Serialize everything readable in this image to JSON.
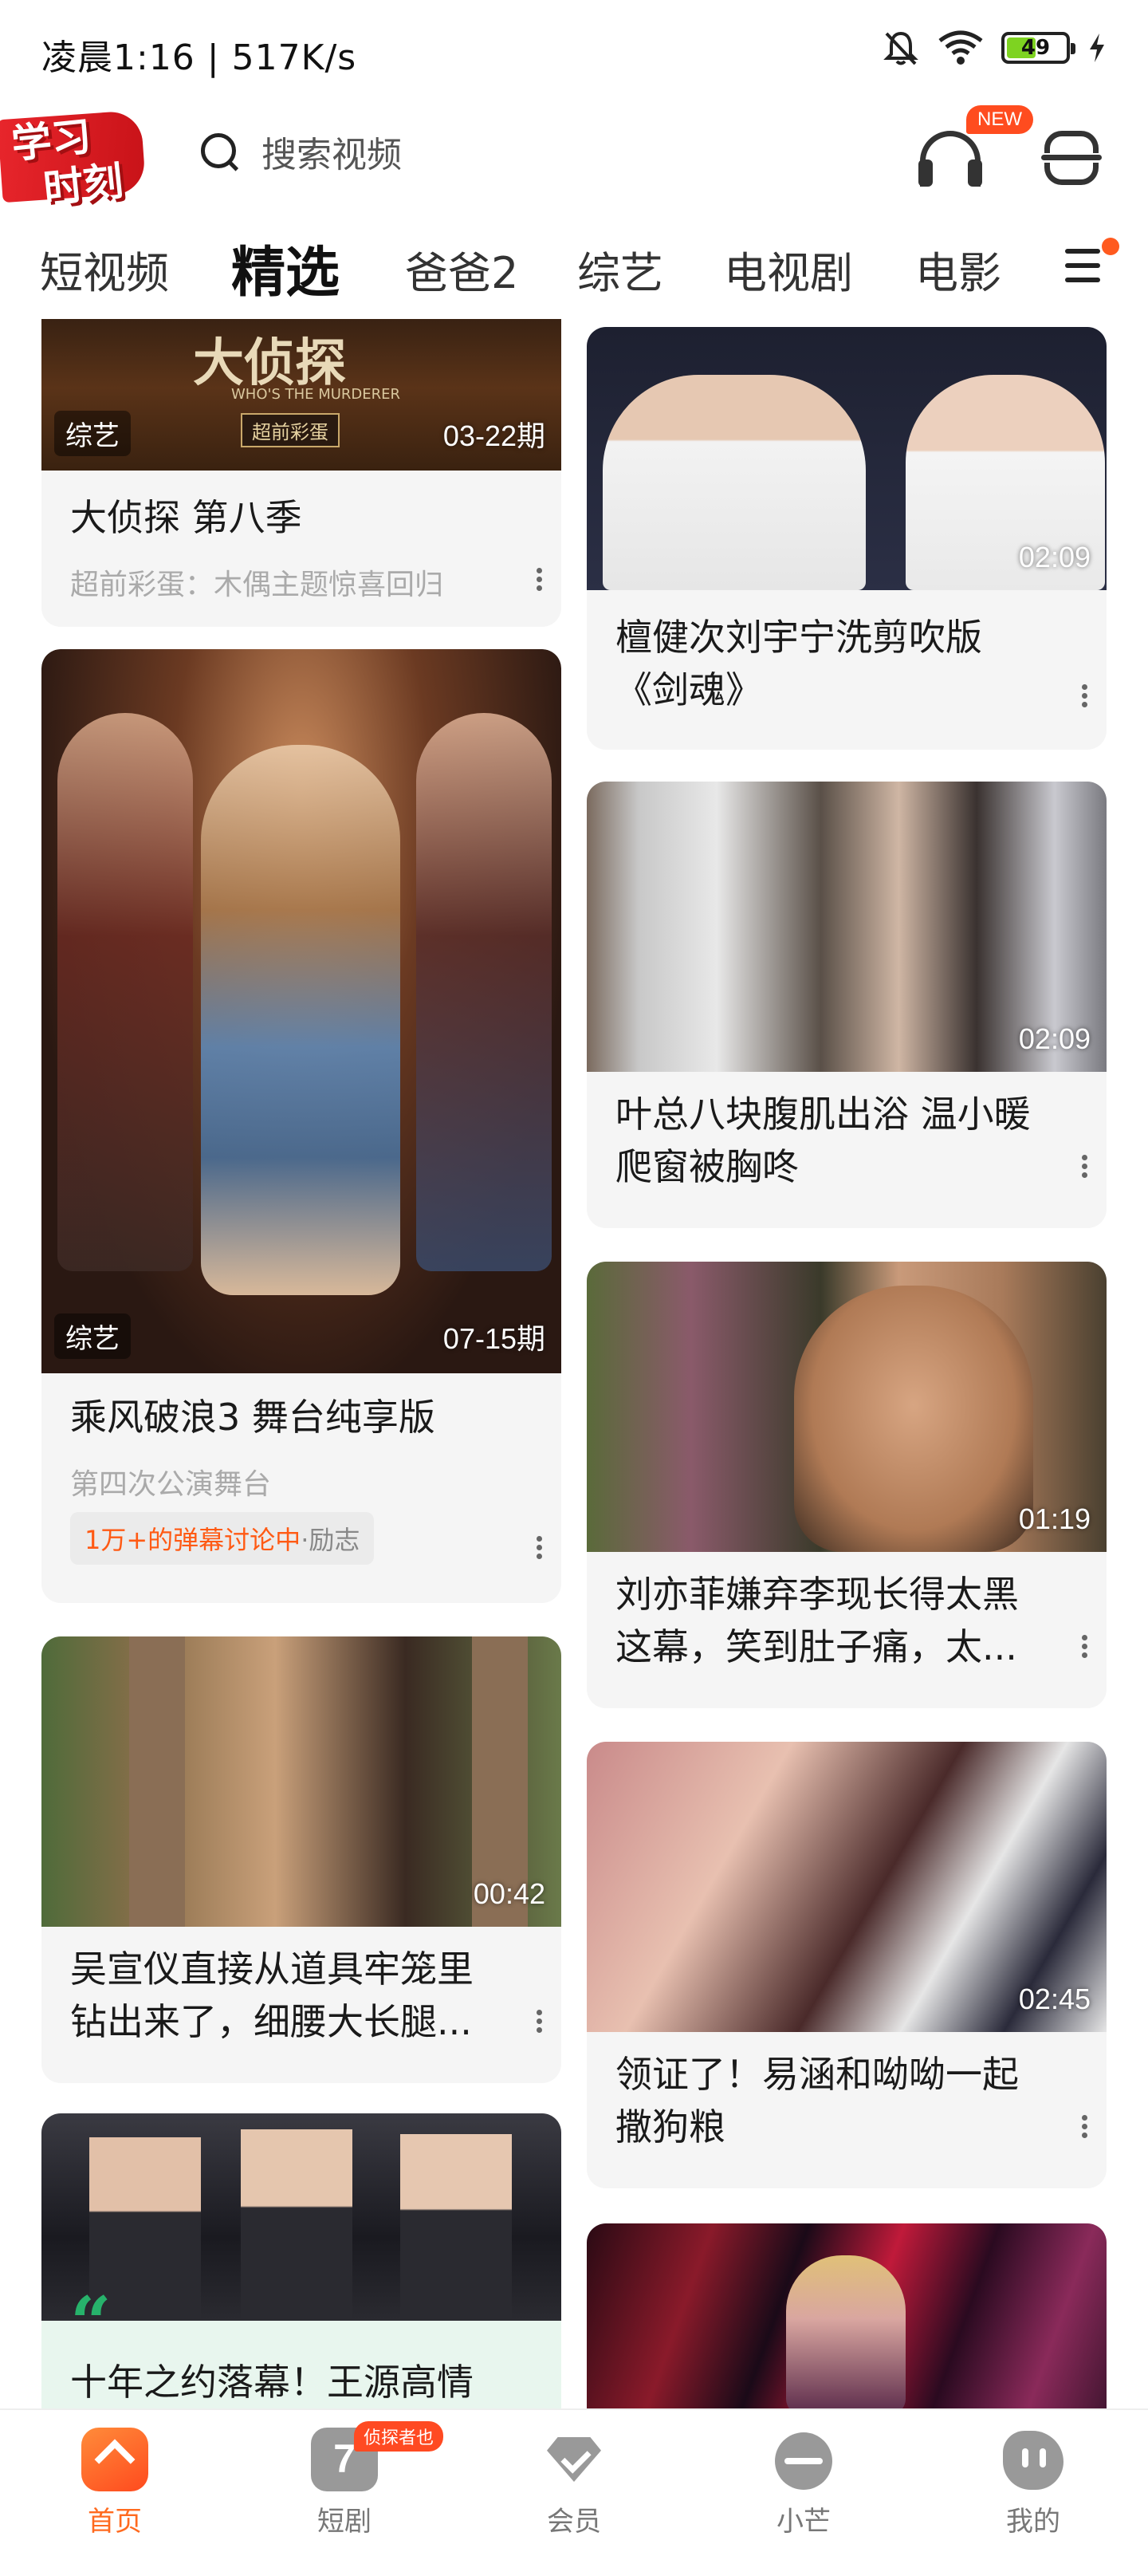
{
  "status_bar": {
    "time_speed": "凌晨1:16 | 517K/s",
    "battery": "49",
    "icons": [
      "bell-muted-icon",
      "wifi-icon",
      "battery-icon",
      "charging-icon"
    ]
  },
  "header": {
    "logo_line1": "学习",
    "logo_line2": "时刻",
    "search_placeholder": "搜索视频",
    "new_badge": "NEW"
  },
  "tabs": [
    {
      "label": "短视频"
    },
    {
      "label": "精选",
      "active": true
    },
    {
      "label": "爸爸2"
    },
    {
      "label": "综艺"
    },
    {
      "label": "电视剧"
    },
    {
      "label": "电影"
    }
  ],
  "cards": [
    {
      "tag": "综艺",
      "duration": "03-22期",
      "title": "大侦探 第八季",
      "subtitle": "超前彩蛋：木偶主题惊喜回归",
      "thumb_text": "大侦探",
      "thumb_sub": "WHO'S THE MURDERER",
      "thumb_caption": "超前彩蛋"
    },
    {
      "duration": "02:09",
      "title": "檀健次刘宇宁洗剪吹版《剑魂》"
    },
    {
      "tag": "综艺",
      "duration": "07-15期",
      "title": "乘风破浪3 舞台纯享版",
      "subtitle": "第四次公演舞台",
      "pill_highlight": "1万+的弹幕讨论中",
      "pill_label": "·励志"
    },
    {
      "duration": "02:09",
      "title": "叶总八块腹肌出浴 温小暖爬窗被胸咚"
    },
    {
      "duration": "01:19",
      "title": "刘亦菲嫌弃李现长得太黑这幕，笑到肚子痛，太..."
    },
    {
      "duration": "00:42",
      "title": "吴宣仪直接从道具牢笼里钻出来了，细腰大长腿..."
    },
    {
      "duration": "02:45",
      "title": "领证了！易涵和呦呦一起撒狗粮"
    },
    {
      "quote": "“",
      "title": "十年之约落幕！王源高情"
    },
    {}
  ],
  "bottom_nav": [
    {
      "label": "首页",
      "icon": "home-icon",
      "active": true
    },
    {
      "label": "短剧",
      "icon": "short-drama-icon",
      "badge": "侦探者也"
    },
    {
      "label": "会员",
      "icon": "vip-icon"
    },
    {
      "label": "小芒",
      "icon": "mango-icon"
    },
    {
      "label": "我的",
      "icon": "profile-icon"
    }
  ],
  "colors": {
    "accent": "#ff6a1f",
    "badge": "#ff4c1f",
    "card_bg": "#f5f5f5",
    "highlight_text": "#ff5a14",
    "quote_green": "#27b26b"
  }
}
